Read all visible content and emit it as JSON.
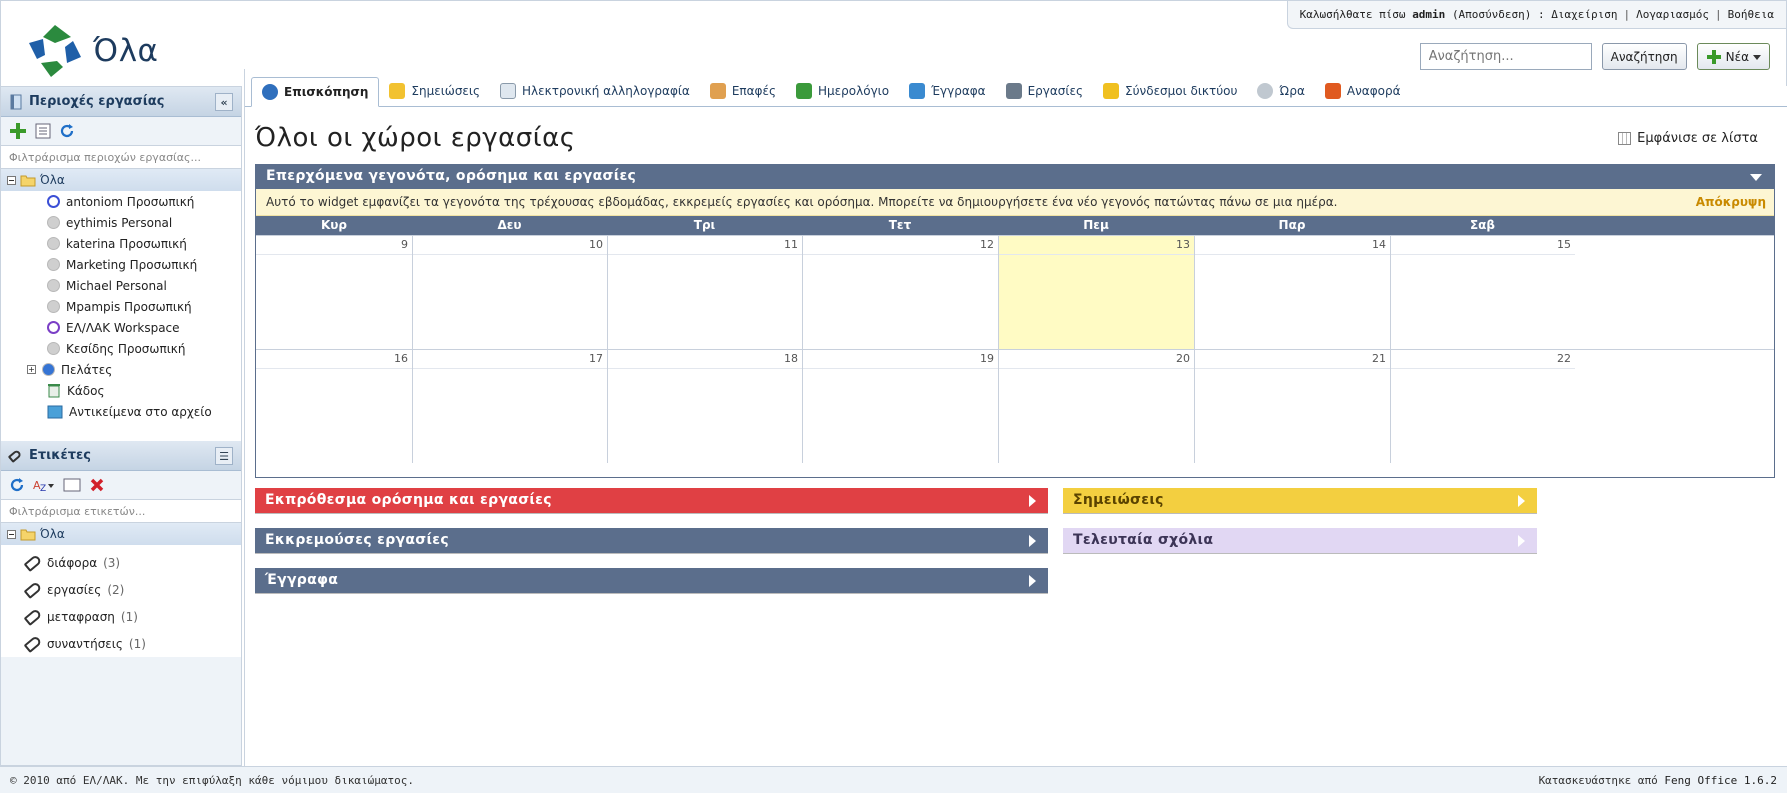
{
  "app": {
    "title": "Όλα"
  },
  "topbar": {
    "welcome_prefix": "Καλωσήλθατε πίσω",
    "user": "admin",
    "logout": "(Αποσύνδεση)",
    "colon": ":",
    "admin_link": "Διαχείριση",
    "account_link": "Λογαριασμός",
    "help_link": "Βοήθεια"
  },
  "search": {
    "placeholder": "Αναζήτηση...",
    "button": "Αναζήτηση",
    "new_button": "Νέα"
  },
  "workspaces": {
    "title": "Περιοχές εργασίας",
    "filter_placeholder": "Φιλτράρισμα περιοχών εργασίας...",
    "root": "Όλα",
    "items": [
      {
        "label": "antoniom Προσωπική",
        "color": "#3b4fd6",
        "style": "ring"
      },
      {
        "label": "eythimis Personal",
        "color": "#cfcfcf",
        "style": "dot"
      },
      {
        "label": "katerina Προσωπική",
        "color": "#cfcfcf",
        "style": "dot"
      },
      {
        "label": "Marketing Προσωπική",
        "color": "#cfcfcf",
        "style": "dot"
      },
      {
        "label": "Michael Personal",
        "color": "#cfcfcf",
        "style": "dot"
      },
      {
        "label": "Mpampis Προσωπική",
        "color": "#cfcfcf",
        "style": "dot"
      },
      {
        "label": "ΕΛ/ΛΑΚ Workspace",
        "color": "#7b3fc6",
        "style": "ring"
      },
      {
        "label": "Κεσίδης Προσωπική",
        "color": "#cfcfcf",
        "style": "dot"
      },
      {
        "label": "Πελάτες",
        "color": "#3574d4",
        "style": "dot"
      }
    ],
    "trash": "Κάδος",
    "archived": "Αντικείμενα στο αρχείο"
  },
  "tags": {
    "title": "Ετικέτες",
    "filter_placeholder": "Φιλτράρισμα ετικετών...",
    "root": "Όλα",
    "items": [
      {
        "label": "διάφορα",
        "count": "(3)"
      },
      {
        "label": "εργασίες",
        "count": "(2)"
      },
      {
        "label": "μεταφραση",
        "count": "(1)"
      },
      {
        "label": "συναντήσεις",
        "count": "(1)"
      }
    ]
  },
  "tabs": [
    {
      "label": "Επισκόπηση",
      "icon": "globe-icon",
      "color": "#2f6fbd",
      "active": true
    },
    {
      "label": "Σημειώσεις",
      "icon": "note-icon",
      "color": "#f2c230",
      "active": false
    },
    {
      "label": "Ηλεκτρονική αλληλογραφία",
      "icon": "mail-icon",
      "color": "#dfe7ef",
      "active": false
    },
    {
      "label": "Επαφές",
      "icon": "contacts-icon",
      "color": "#e0a050",
      "active": false
    },
    {
      "label": "Ημερολόγιο",
      "icon": "calendar-icon",
      "color": "#3b9a3b",
      "active": false
    },
    {
      "label": "Έγγραφα",
      "icon": "documents-icon",
      "color": "#3a8ad0",
      "active": false
    },
    {
      "label": "Εργασίες",
      "icon": "tasks-icon",
      "color": "#6b7a8a",
      "active": false
    },
    {
      "label": "Σύνδεσμοι δικτύου",
      "icon": "star-icon",
      "color": "#f0c020",
      "active": false
    },
    {
      "label": "Ώρα",
      "icon": "clock-icon",
      "color": "#c0c8d0",
      "active": false
    },
    {
      "label": "Αναφορά",
      "icon": "report-icon",
      "color": "#e05a20",
      "active": false
    }
  ],
  "main": {
    "title": "Όλοι οι χώροι εργασίας",
    "list_link": "Εμφάνισε σε λίστα"
  },
  "calendar_widget": {
    "title": "Επερχόμενα γεγονότα, ορόσημα και εργασίες",
    "notice": "Αυτό το widget εμφανίζει τα γεγονότα της τρέχουσας εβδομάδας, εκκρεμείς εργασίες και ορόσημα. Μπορείτε να δημιουργήσετε ένα νέο γεγονός πατώντας πάνω σε μια ημέρα.",
    "hide": "Απόκρυψη",
    "days": [
      "Κυρ",
      "Δευ",
      "Τρι",
      "Τετ",
      "Πεμ",
      "Παρ",
      "Σαβ"
    ],
    "weeks": [
      [
        "9",
        "10",
        "11",
        "12",
        "13",
        "14",
        "15"
      ],
      [
        "16",
        "17",
        "18",
        "19",
        "20",
        "21",
        "22"
      ]
    ],
    "today": "13"
  },
  "widgets": {
    "overdue": "Εκπρόθεσμα ορόσημα και εργασίες",
    "pending": "Εκκρεμούσες εργασίες",
    "documents": "Έγγραφα",
    "notes": "Σημειώσεις",
    "comments": "Τελευταία σχόλια"
  },
  "footer": {
    "copyright": "© 2010 από ΕΛ/ΛΑΚ. Με την επιφύλαξη κάθε νόμιμου δικαιώματος.",
    "built_by_prefix": "Κατασκευάστηκε από",
    "product": "Feng Office 1.6.2"
  }
}
